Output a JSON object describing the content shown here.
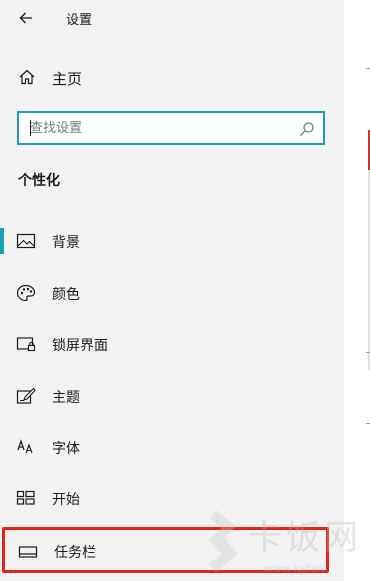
{
  "window": {
    "title": "设置",
    "back_icon": "arrow-left-icon"
  },
  "home": {
    "label": "主页",
    "icon": "home-icon"
  },
  "search": {
    "placeholder": "查找设置",
    "value": "",
    "icon": "search-icon",
    "focus_color": "#1c9db2"
  },
  "section": {
    "title": "个性化"
  },
  "nav": {
    "items": [
      {
        "label": "背景",
        "icon": "picture-icon",
        "selected": true
      },
      {
        "label": "颜色",
        "icon": "palette-icon",
        "selected": false
      },
      {
        "label": "锁屏界面",
        "icon": "lock-screen-icon",
        "selected": false
      },
      {
        "label": "主题",
        "icon": "theme-brush-icon",
        "selected": false
      },
      {
        "label": "字体",
        "icon": "font-icon",
        "selected": false
      },
      {
        "label": "开始",
        "icon": "start-tiles-icon",
        "selected": false
      },
      {
        "label": "任务栏",
        "icon": "taskbar-icon",
        "selected": false,
        "highlighted": true
      }
    ]
  },
  "colors": {
    "accent": "#1c9db2",
    "highlight_border": "#e0251b",
    "pane_bg": "#f2f2f2"
  },
  "watermark": {
    "text": "卡饭网",
    "url": "www.kafan"
  }
}
